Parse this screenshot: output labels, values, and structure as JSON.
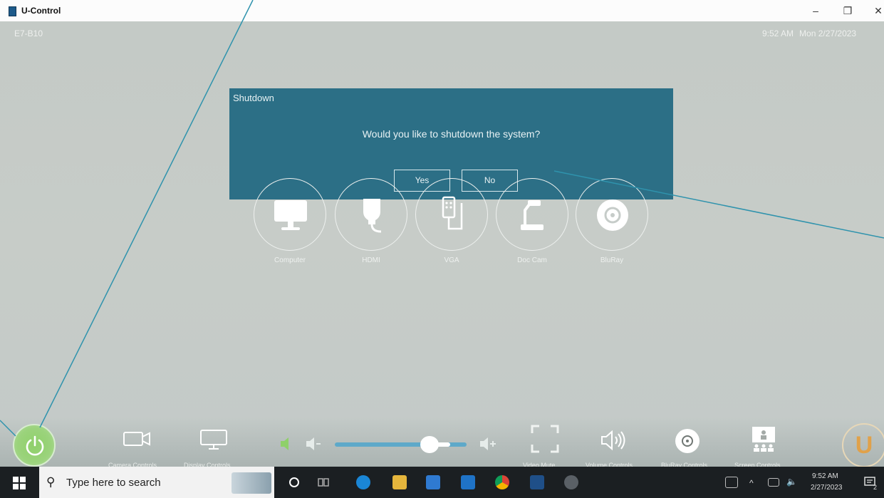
{
  "window": {
    "title": "U-Control",
    "minimize": "–",
    "maximize": "❐",
    "close": "✕"
  },
  "header": {
    "room": "E7-B10",
    "time": "9:52 AM",
    "date": "Mon 2/27/2023"
  },
  "dialog": {
    "title": "Shutdown",
    "message": "Would you like to shutdown the system?",
    "yes_label": "Yes",
    "no_label": "No"
  },
  "sources": [
    {
      "label": "Computer",
      "icon": "monitor-icon"
    },
    {
      "label": "HDMI",
      "icon": "hdmi-icon"
    },
    {
      "label": "VGA",
      "icon": "vga-icon"
    },
    {
      "label": "Doc Cam",
      "icon": "document-camera-icon"
    },
    {
      "label": "BluRay",
      "icon": "disc-icon"
    }
  ],
  "controls": {
    "camera_label": "Camera Controls",
    "display_label": "Display Controls",
    "volume_level": 0.82,
    "video_mute_label": "Video Mute",
    "volume_label": "Volume Controls",
    "bluray_label": "BluRay Controls",
    "screen_label": "Screen Controls",
    "logo_letter": "U"
  },
  "taskbar": {
    "search_placeholder": "Type here to search",
    "clock_time": "9:52 AM",
    "clock_date": "2/27/2023",
    "notification_count": "2"
  },
  "colors": {
    "dialog_bg": "#2c6f86",
    "annotation_line": "#2f93ad",
    "power_green": "#8fd06a",
    "slider_blue": "#5ea9c9"
  }
}
